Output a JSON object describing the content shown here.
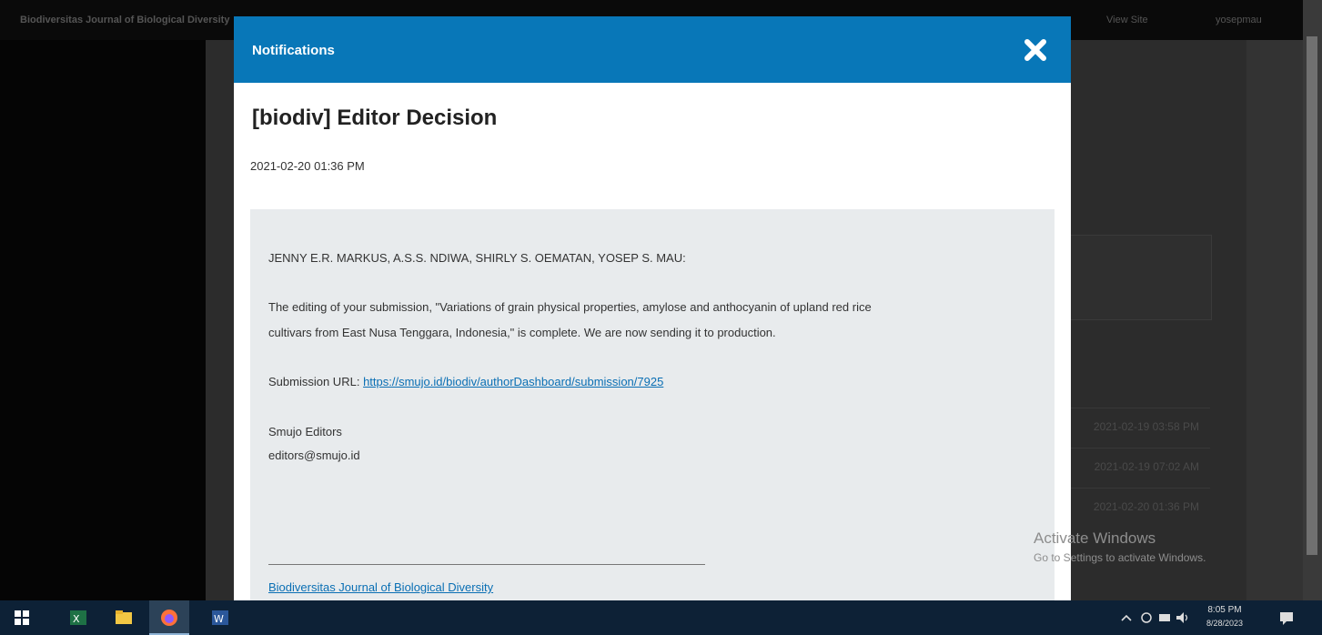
{
  "background": {
    "site_title": "Biodiversitas Journal of Biological Diversity",
    "view_site": "View Site",
    "username": "yosepmau",
    "rows": [
      "2021-02-19 03:58 PM",
      "2021-02-19 07:02 AM",
      "2021-02-20 01:36 PM"
    ]
  },
  "modal": {
    "title": "Notifications",
    "close_icon": "close-icon",
    "subject": "[biodiv] Editor Decision",
    "date": "2021-02-20 01:36 PM",
    "body": {
      "authors": "JENNY E.R. MARKUS, A.S.S. NDIWA, SHIRLY S. OEMATAN, YOSEP S. MAU:",
      "line1": "The editing of your submission, \"Variations of grain physical properties, amylose and anthocyanin of upland red rice",
      "line2": "cultivars from East Nusa Tenggara, Indonesia,\" is complete. We are now sending it to production.",
      "url_label": "Submission URL:",
      "url": "https://smujo.id/biodiv/authorDashboard/submission/7925",
      "signature_name": "Smujo Editors",
      "signature_email": "editors@smujo.id",
      "footer_link": "Biodiversitas Journal of Biological Diversity"
    }
  },
  "watermark": {
    "line1": "Activate Windows",
    "line2": "Go to Settings to activate Windows."
  },
  "taskbar": {
    "apps": [
      "windows-start-icon",
      "excel-icon",
      "file-explorer-icon",
      "firefox-icon",
      "word-icon"
    ],
    "time": "8:05 PM",
    "date": "8/28/2023"
  },
  "colors": {
    "header_blue": "#0877b8",
    "link_blue": "#0a6fb4",
    "body_gray": "#e8ebed",
    "taskbar": "#0d2136"
  }
}
